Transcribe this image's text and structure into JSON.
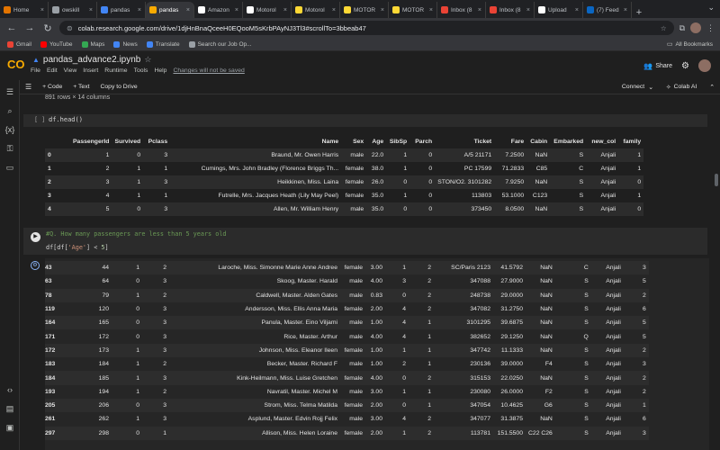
{
  "browser": {
    "tabs": [
      {
        "label": "Home",
        "color": "#e37400"
      },
      {
        "label": "owskill",
        "color": "#9aa0a6"
      },
      {
        "label": "pandas",
        "color": "#4285f4"
      },
      {
        "label": "pandas",
        "color": "#f9ab00",
        "active": true
      },
      {
        "label": "Amazon",
        "color": "#ffffff"
      },
      {
        "label": "Motorol",
        "color": "#ffffff"
      },
      {
        "label": "Motorol",
        "color": "#fdd835"
      },
      {
        "label": "MOTOR",
        "color": "#fdd835"
      },
      {
        "label": "MOTOR",
        "color": "#fdd835"
      },
      {
        "label": "Inbox (8",
        "color": "#ea4335"
      },
      {
        "label": "Inbox (8",
        "color": "#ea4335"
      },
      {
        "label": "Upload",
        "color": "#ffffff"
      },
      {
        "label": "(7) Feed",
        "color": "#0a66c2"
      }
    ],
    "url": "colab.research.google.com/drive/1djHnBnaQceeH0EQooM5sKrbPAyNJ3Tl3#scrollTo=3bbeab47",
    "bookmarks": [
      {
        "label": "Gmail",
        "color": "#ea4335"
      },
      {
        "label": "YouTube",
        "color": "#ff0000"
      },
      {
        "label": "Maps",
        "color": "#34a853"
      },
      {
        "label": "News",
        "color": "#4285f4"
      },
      {
        "label": "Translate",
        "color": "#4285f4"
      },
      {
        "label": "Search our Job Op...",
        "color": "#9aa0a6"
      }
    ],
    "all_bookmarks": "All Bookmarks"
  },
  "colab": {
    "logo": "CO",
    "notebook_name": "pandas_advance2.ipynb",
    "menus": [
      "File",
      "Edit",
      "View",
      "Insert",
      "Runtime",
      "Tools",
      "Help"
    ],
    "unsaved": "Changes will not be saved",
    "share": "Share",
    "toolbar": {
      "code": "+ Code",
      "text": "+ Text",
      "copy": "Copy to Drive",
      "connect": "Connect",
      "colab_ai": "Colab AI"
    }
  },
  "notebook": {
    "row_count": "891 rows × 14 columns",
    "cell1": {
      "label": "[ ]",
      "code": "df.head()"
    },
    "head_columns": [
      "",
      "PassengerId",
      "Survived",
      "Pclass",
      "Name",
      "Sex",
      "Age",
      "SibSp",
      "Parch",
      "Ticket",
      "Fare",
      "Cabin",
      "Embarked",
      "new_col",
      "family"
    ],
    "head_rows": [
      [
        "0",
        "1",
        "0",
        "3",
        "Braund, Mr. Owen Harris",
        "male",
        "22.0",
        "1",
        "0",
        "A/5 21171",
        "7.2500",
        "NaN",
        "S",
        "Anjali",
        "1"
      ],
      [
        "1",
        "2",
        "1",
        "1",
        "Cumings, Mrs. John Bradley (Florence Briggs Th...",
        "female",
        "38.0",
        "1",
        "0",
        "PC 17599",
        "71.2833",
        "C85",
        "C",
        "Anjali",
        "1"
      ],
      [
        "2",
        "3",
        "1",
        "3",
        "Heikkinen, Miss. Laina",
        "female",
        "26.0",
        "0",
        "0",
        "STON/O2. 3101282",
        "7.9250",
        "NaN",
        "S",
        "Anjali",
        "0"
      ],
      [
        "3",
        "4",
        "1",
        "1",
        "Futrelle, Mrs. Jacques Heath (Lily May Peel)",
        "female",
        "35.0",
        "1",
        "0",
        "113803",
        "53.1000",
        "C123",
        "S",
        "Anjali",
        "1"
      ],
      [
        "4",
        "5",
        "0",
        "3",
        "Allen, Mr. William Henry",
        "male",
        "35.0",
        "0",
        "0",
        "373450",
        "8.0500",
        "NaN",
        "S",
        "Anjali",
        "0"
      ]
    ],
    "cell2": {
      "comment": "#Q. How many passengers are less than 5 years old",
      "code_prefix": "df[df[",
      "code_str": "'Age'",
      "code_mid": "] < ",
      "code_num": "5",
      "code_suffix": "]"
    },
    "result_rows": [
      [
        "43",
        "44",
        "1",
        "2",
        "Laroche, Miss. Simonne Marie Anne Andree",
        "female",
        "3.00",
        "1",
        "2",
        "SC/Paris 2123",
        "41.5792",
        "NaN",
        "C",
        "Anjali",
        "3"
      ],
      [
        "63",
        "64",
        "0",
        "3",
        "Skoog, Master. Harald",
        "male",
        "4.00",
        "3",
        "2",
        "347088",
        "27.9000",
        "NaN",
        "S",
        "Anjali",
        "5"
      ],
      [
        "78",
        "79",
        "1",
        "2",
        "Caldwell, Master. Alden Gates",
        "male",
        "0.83",
        "0",
        "2",
        "248738",
        "29.0000",
        "NaN",
        "S",
        "Anjali",
        "2"
      ],
      [
        "119",
        "120",
        "0",
        "3",
        "Andersson, Miss. Ellis Anna Maria",
        "female",
        "2.00",
        "4",
        "2",
        "347082",
        "31.2750",
        "NaN",
        "S",
        "Anjali",
        "6"
      ],
      [
        "164",
        "165",
        "0",
        "3",
        "Panula, Master. Eino Viljami",
        "male",
        "1.00",
        "4",
        "1",
        "3101295",
        "39.6875",
        "NaN",
        "S",
        "Anjali",
        "5"
      ],
      [
        "171",
        "172",
        "0",
        "3",
        "Rice, Master. Arthur",
        "male",
        "4.00",
        "4",
        "1",
        "382652",
        "29.1250",
        "NaN",
        "Q",
        "Anjali",
        "5"
      ],
      [
        "172",
        "173",
        "1",
        "3",
        "Johnson, Miss. Eleanor Ileen",
        "female",
        "1.00",
        "1",
        "1",
        "347742",
        "11.1333",
        "NaN",
        "S",
        "Anjali",
        "2"
      ],
      [
        "183",
        "184",
        "1",
        "2",
        "Becker, Master. Richard F",
        "male",
        "1.00",
        "2",
        "1",
        "230136",
        "39.0000",
        "F4",
        "S",
        "Anjali",
        "3"
      ],
      [
        "184",
        "185",
        "1",
        "3",
        "Kink-Heilmann, Miss. Luise Gretchen",
        "female",
        "4.00",
        "0",
        "2",
        "315153",
        "22.0250",
        "NaN",
        "S",
        "Anjali",
        "2"
      ],
      [
        "193",
        "194",
        "1",
        "2",
        "Navratil, Master. Michel M",
        "male",
        "3.00",
        "1",
        "1",
        "230080",
        "26.0000",
        "F2",
        "S",
        "Anjali",
        "2"
      ],
      [
        "205",
        "206",
        "0",
        "3",
        "Strom, Miss. Telma Matilda",
        "female",
        "2.00",
        "0",
        "1",
        "347054",
        "10.4625",
        "G6",
        "S",
        "Anjali",
        "1"
      ],
      [
        "261",
        "262",
        "1",
        "3",
        "Asplund, Master. Edvin Rojj Felix",
        "male",
        "3.00",
        "4",
        "2",
        "347077",
        "31.3875",
        "NaN",
        "S",
        "Anjali",
        "6"
      ],
      [
        "297",
        "298",
        "0",
        "1",
        "Allison, Miss. Helen Loraine",
        "female",
        "2.00",
        "1",
        "2",
        "113781",
        "151.5500",
        "C22 C26",
        "S",
        "Anjali",
        "3"
      ]
    ]
  }
}
